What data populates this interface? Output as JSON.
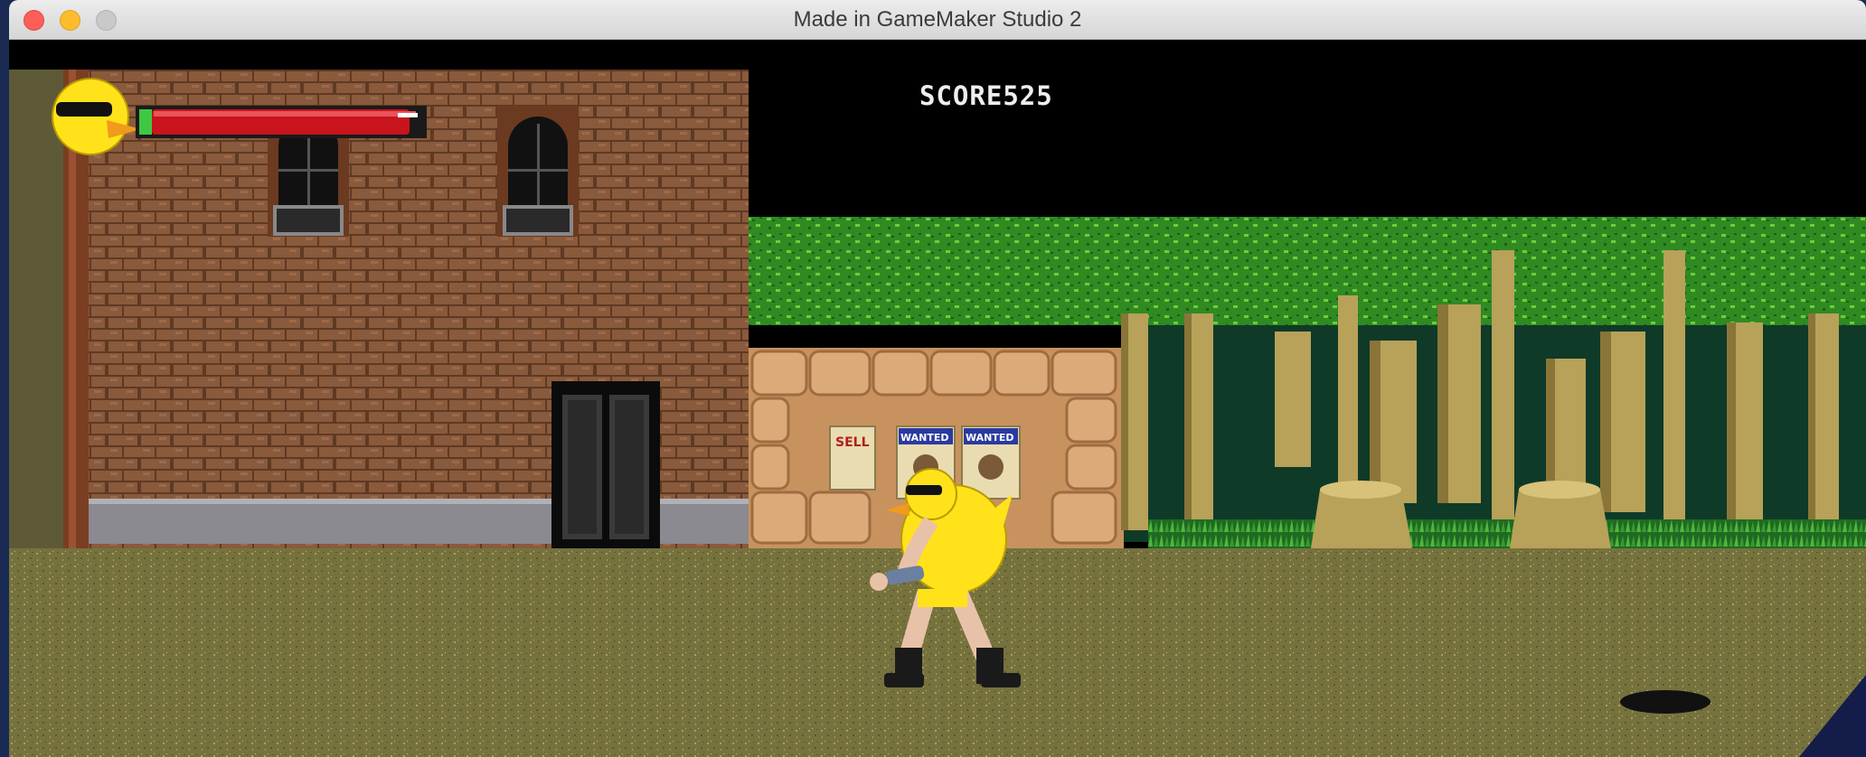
{
  "window": {
    "title": "Made in GameMaker Studio 2"
  },
  "hud": {
    "score_label": "SCORE",
    "score_value": "525",
    "health": 0.95
  },
  "posters": [
    "SELL",
    "WANTED",
    "WANTED"
  ],
  "colors": {
    "brick": "#8a5a3c",
    "mortar": "#6b4329",
    "ground": "#77733e",
    "leaves": "#3c9a28",
    "trunk": "#b8a159",
    "stone": "#d9a773",
    "duck": "#ffe21a",
    "health": "#c8141c"
  }
}
